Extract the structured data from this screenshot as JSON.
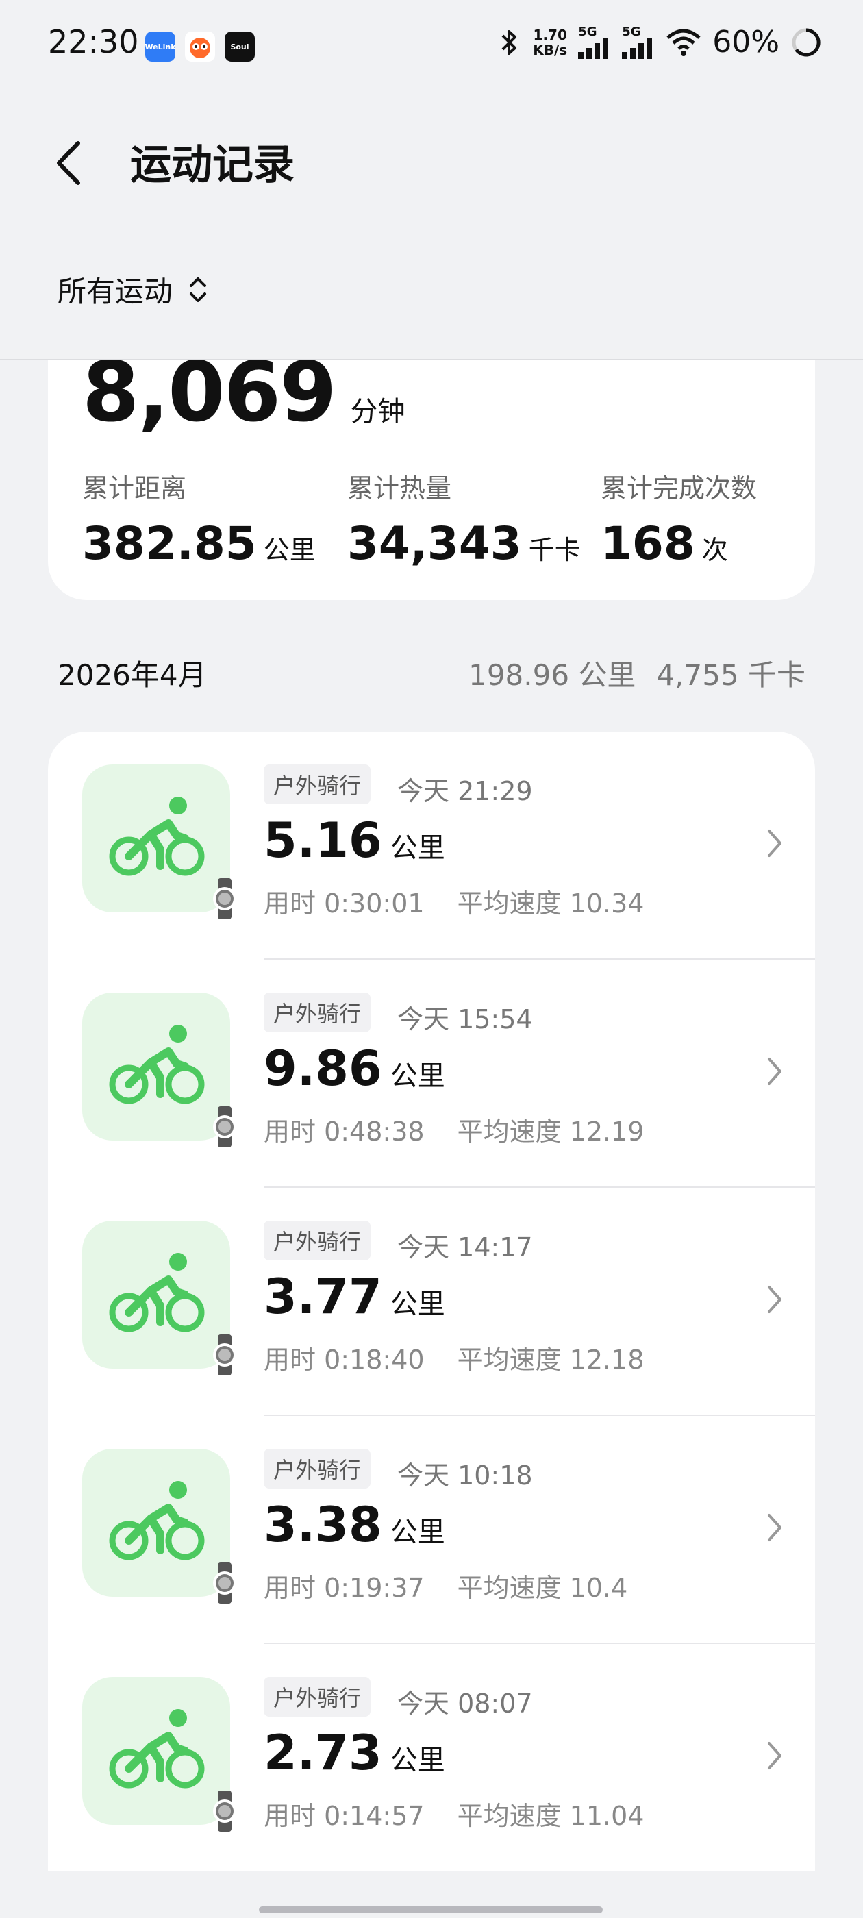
{
  "status_bar": {
    "time": "22:30",
    "app_icons": [
      {
        "name": "welink-icon",
        "label": "WeLink",
        "color": "#2f7cf6"
      },
      {
        "name": "fox-app-icon",
        "label": "",
        "color": "#ff6a2a"
      },
      {
        "name": "soul-icon",
        "label": "Soul",
        "color": "#111111"
      }
    ],
    "net_speed_value": "1.70",
    "net_speed_unit": "KB/s",
    "sim1_label": "5G",
    "sim2_label": "5G",
    "battery": "60%"
  },
  "header": {
    "title": "运动记录"
  },
  "filter": {
    "label": "所有运动"
  },
  "summary": {
    "total_minutes": "8,069",
    "total_minutes_unit": "分钟",
    "stats": [
      {
        "label": "累计距离",
        "value": "382.85",
        "unit": "公里"
      },
      {
        "label": "累计热量",
        "value": "34,343",
        "unit": "千卡"
      },
      {
        "label": "累计完成次数",
        "value": "168",
        "unit": "次"
      }
    ]
  },
  "month": {
    "label": "2026年4月",
    "distance": "198.96 公里",
    "calories": "4,755 千卡"
  },
  "records": [
    {
      "type": "户外骑行",
      "time": "今天 21:29",
      "distance": "5.16",
      "unit": "公里",
      "duration": "用时 0:30:01",
      "avg_speed": "平均速度 10.34"
    },
    {
      "type": "户外骑行",
      "time": "今天 15:54",
      "distance": "9.86",
      "unit": "公里",
      "duration": "用时 0:48:38",
      "avg_speed": "平均速度 12.19"
    },
    {
      "type": "户外骑行",
      "time": "今天 14:17",
      "distance": "3.77",
      "unit": "公里",
      "duration": "用时 0:18:40",
      "avg_speed": "平均速度 12.18"
    },
    {
      "type": "户外骑行",
      "time": "今天 10:18",
      "distance": "3.38",
      "unit": "公里",
      "duration": "用时 0:19:37",
      "avg_speed": "平均速度 10.4"
    },
    {
      "type": "户外骑行",
      "time": "今天 08:07",
      "distance": "2.73",
      "unit": "公里",
      "duration": "用时 0:14:57",
      "avg_speed": "平均速度 11.04"
    }
  ],
  "colors": {
    "accent_green": "#4cc95f",
    "icon_bg": "#e6f7e7",
    "background": "#f1f2f4"
  }
}
